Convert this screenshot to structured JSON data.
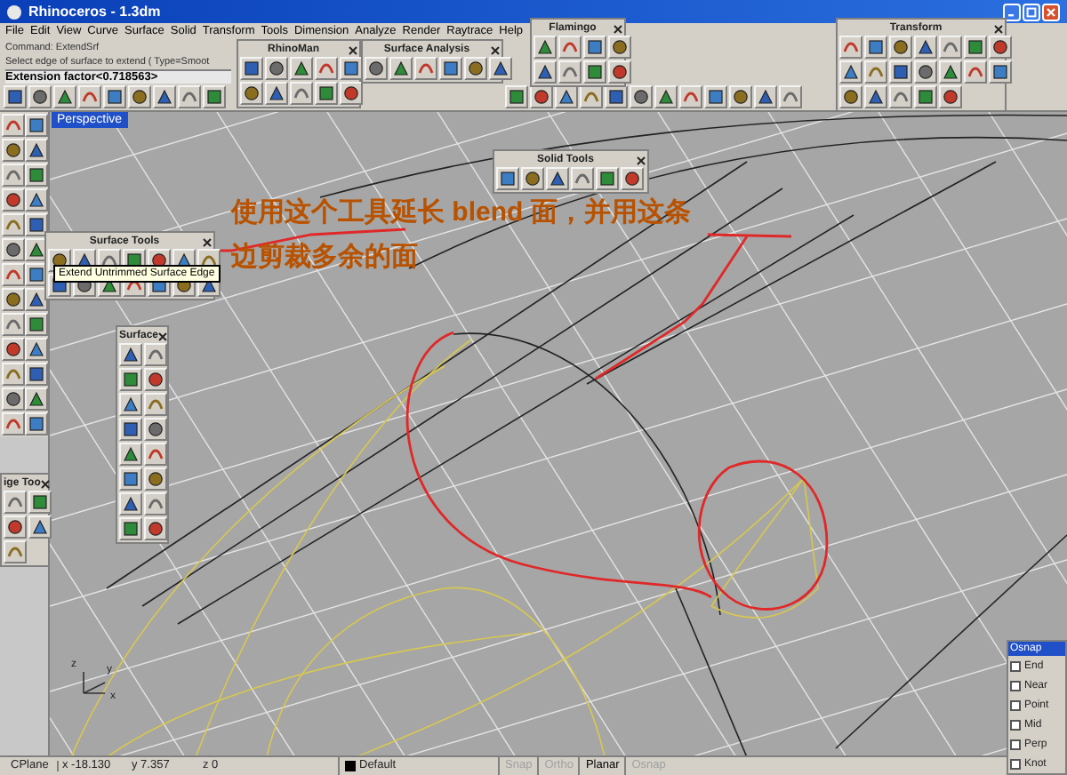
{
  "window": {
    "title": "Rhinoceros - 1.3dm"
  },
  "menu": [
    "File",
    "Edit",
    "View",
    "Curve",
    "Surface",
    "Solid",
    "Transform",
    "Tools",
    "Dimension",
    "Analyze",
    "Render",
    "Raytrace",
    "Help"
  ],
  "command_lines": [
    "Command: ExtendSrf",
    "Select edge of surface to extend ( Type=Smoot"
  ],
  "command_prompt": "Extension factor<0.718563>",
  "viewport": {
    "label": "Perspective",
    "annotation_lines": [
      "使用这个工具延长 blend 面，并用这条",
      "边剪裁多余的面"
    ],
    "axis_labels": [
      "z",
      "y",
      "x"
    ]
  },
  "toolbars": [
    {
      "title": "RhinoMan"
    },
    {
      "title": "Surface Analysis"
    },
    {
      "title": "Flamingo"
    },
    {
      "title": "Transform"
    },
    {
      "title": "Solid Tools"
    },
    {
      "title": "Surface Tools"
    },
    {
      "title": "Surface"
    },
    {
      "title": "ige Too"
    }
  ],
  "tooltip": "Extend Untrimmed Surface Edge",
  "osnap": {
    "title": "Osnap",
    "items": [
      {
        "label": "End",
        "checked": false
      },
      {
        "label": "Near",
        "checked": false
      },
      {
        "label": "Point",
        "checked": false
      },
      {
        "label": "Mid",
        "checked": false
      },
      {
        "label": "Perp",
        "checked": false
      },
      {
        "label": "Knot",
        "checked": false
      }
    ]
  },
  "status_bar": {
    "cplane": "CPlane",
    "x": "x -18.130",
    "y": "y 7.357",
    "z": "z 0",
    "layer": "Default",
    "toggles": [
      {
        "label": "Snap",
        "on": false
      },
      {
        "label": "Ortho",
        "on": false
      },
      {
        "label": "Planar",
        "on": true
      },
      {
        "label": "Osnap",
        "on": false
      }
    ]
  }
}
